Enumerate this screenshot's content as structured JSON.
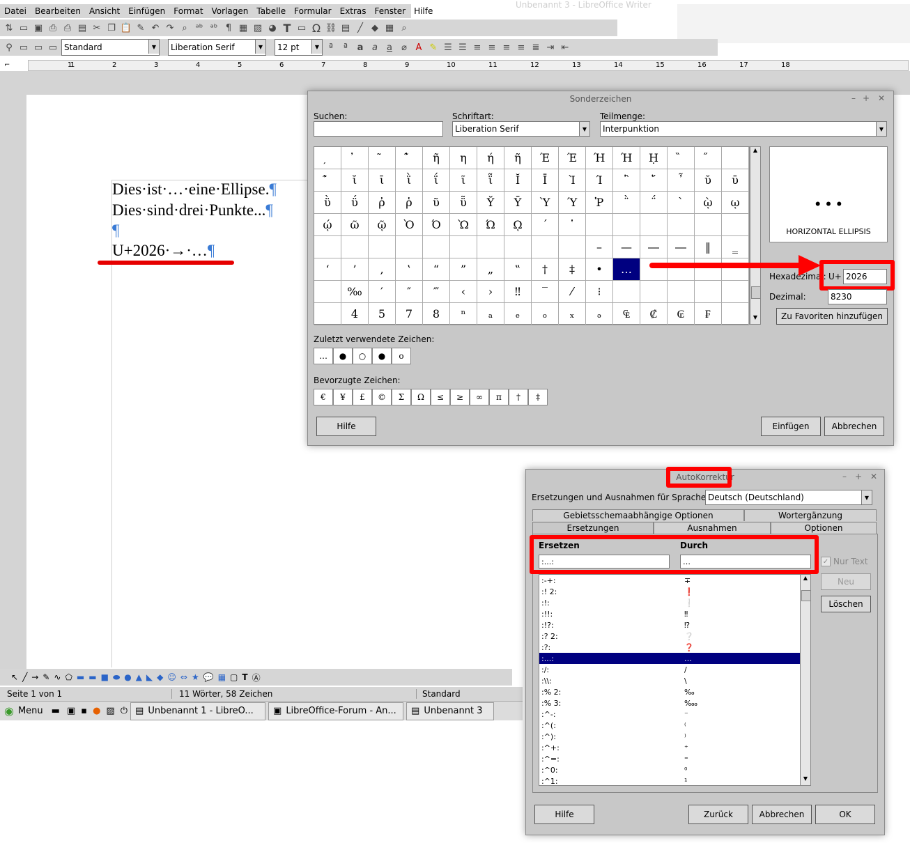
{
  "app": {
    "title_ghost": "Unbenannt 3 - LibreOffice Writer",
    "menu": [
      "Datei",
      "Bearbeiten",
      "Ansicht",
      "Einfügen",
      "Format",
      "Vorlagen",
      "Tabelle",
      "Formular",
      "Extras",
      "Fenster",
      "Hilfe"
    ],
    "para_style": "Standard",
    "font_name": "Liberation Serif",
    "font_size": "12 pt",
    "ruler_numbers": [
      "1",
      "1",
      "2",
      "3",
      "4",
      "5",
      "6",
      "7",
      "8",
      "9",
      "10",
      "11",
      "12",
      "13",
      "14",
      "15",
      "16",
      "17",
      "18"
    ]
  },
  "document": {
    "line1_a": "Dies·ist·…·eine·Ellipse.",
    "line2_a": "Dies·sind·drei·Punkte...",
    "line4_a": "U+2026·→·…",
    "pilcrow": "¶"
  },
  "status": {
    "page": "Seite 1 von 1",
    "words": "11 Wörter, 58 Zeichen",
    "style": "Standard"
  },
  "taskbar": {
    "menu": "Menu",
    "task1": "Unbenannt 1 - LibreO...",
    "task2": "LibreOffice-Forum - An...",
    "task3": "Unbenannt 3"
  },
  "special_chars": {
    "title": "Sonderzeichen",
    "search_label": "Suchen:",
    "search_value": "",
    "font_label": "Schriftart:",
    "font_value": "Liberation Serif",
    "subset_label": "Teilmenge:",
    "subset_value": "Interpunktion",
    "grid": [
      "̦",
      "̓",
      "̃",
      "̓̃",
      "ῆ",
      "η",
      "ή",
      "ῆ",
      "Έ",
      "Έ",
      "Ή",
      "Ή",
      "Ḥ",
      "̏",
      "̋",
      "",
      "̓̃",
      "ῐ",
      "ῑ",
      "ῒ",
      "ΐ",
      "ῖ",
      "ῗ",
      "Ῐ",
      "Ῑ",
      "Ὶ",
      "Ί",
      "῍",
      "῎",
      "῏",
      "ῠ",
      "ῡ",
      "ῢ",
      "ΰ",
      "ῤ",
      "ῥ",
      "ῦ",
      "ῧ",
      "Ῠ",
      "Ῡ",
      "Ὺ",
      "Ύ",
      "Ῥ",
      "῭",
      "΅",
      "`",
      "ῲ",
      "ῳ",
      "ῴ",
      "ῶ",
      "ῷ",
      "Ὸ",
      "Ό",
      "Ὼ",
      "Ώ",
      "ῼ",
      "´",
      "῾",
      "",
      "",
      "",
      "",
      "",
      "",
      "",
      "",
      "",
      "",
      "",
      "",
      "",
      "",
      "",
      "",
      "–",
      "—",
      "―",
      "―",
      "‖",
      "‗",
      "‘",
      "’",
      "‚",
      "‛",
      "“",
      "”",
      "„",
      "‟",
      "†",
      "‡",
      "•",
      "…",
      "",
      "",
      "",
      "",
      "",
      "‰",
      "′",
      "″",
      "‴",
      "‹",
      "›",
      "‼",
      "‾",
      "⁄",
      "⁝",
      "",
      "",
      "",
      "",
      "",
      "",
      "4",
      "5",
      "7",
      "8",
      "ⁿ",
      "ₐ",
      "ₑ",
      "ₒ",
      "ₓ",
      "ₔ",
      "₠",
      "₡",
      "₢",
      "₣",
      ""
    ],
    "preview_char": "…",
    "char_name": "HORIZONTAL ELLIPSIS",
    "hex_label": "Hexadezimal:",
    "hex_prefix": "U+",
    "hex_value": "2026",
    "dec_label": "Dezimal:",
    "dec_value": "8230",
    "fav_add_button": "Zu Favoriten hinzufügen",
    "recent_label": "Zuletzt verwendete Zeichen:",
    "recent": [
      "…",
      "●",
      "○",
      "●",
      "o"
    ],
    "favorites_label": "Bevorzugte Zeichen:",
    "favorites": [
      "€",
      "¥",
      "£",
      "©",
      "Σ",
      "Ω",
      "≤",
      "≥",
      "∞",
      "π",
      "†",
      "‡"
    ],
    "help_button": "Hilfe",
    "insert_button": "Einfügen",
    "cancel_button": "Abbrechen"
  },
  "autocorrect": {
    "title": "AutoKorrektur",
    "lang_label": "Ersetzungen und Ausnahmen für Sprache:",
    "lang_value": "Deutsch (Deutschland)",
    "tabs_top": [
      "Gebietsschemaabhängige Optionen",
      "Wortergänzung"
    ],
    "tabs_bottom": [
      "Ersetzungen",
      "Ausnahmen",
      "Optionen"
    ],
    "col_replace": "Ersetzen",
    "col_with": "Durch",
    "replace_value": ":...:",
    "with_value": "…",
    "text_only_label": "Nur Text",
    "new_button": "Neu",
    "delete_button": "Löschen",
    "rows": [
      {
        "a": ":-+:",
        "b": "∓"
      },
      {
        "a": ":! 2:",
        "b": "❗"
      },
      {
        "a": ":!:",
        "b": "❕"
      },
      {
        "a": ":!!:",
        "b": "‼"
      },
      {
        "a": ":!?:",
        "b": "⁉"
      },
      {
        "a": ":? 2:",
        "b": "❔"
      },
      {
        "a": ":?:",
        "b": "❓"
      },
      {
        "a": ":...:",
        "b": "…"
      },
      {
        "a": ":/:",
        "b": "/"
      },
      {
        "a": ":\\\\:",
        "b": "\\"
      },
      {
        "a": ":% 2:",
        "b": "‰"
      },
      {
        "a": ":% 3:",
        "b": "‱"
      },
      {
        "a": ":^-:",
        "b": "⁻"
      },
      {
        "a": ":^(:",
        "b": "⁽"
      },
      {
        "a": ":^):",
        "b": "⁾"
      },
      {
        "a": ":^+:",
        "b": "⁺"
      },
      {
        "a": ":^=:",
        "b": "⁼"
      },
      {
        "a": ":^0:",
        "b": "⁰"
      },
      {
        "a": ":^1:",
        "b": "¹"
      }
    ],
    "help_button": "Hilfe",
    "back_button": "Zurück",
    "cancel_button": "Abbrechen",
    "ok_button": "OK"
  },
  "colors": {
    "highlight_red": "#ff0000",
    "selection": "#000080",
    "pilcrow": "#3a7bd5"
  }
}
